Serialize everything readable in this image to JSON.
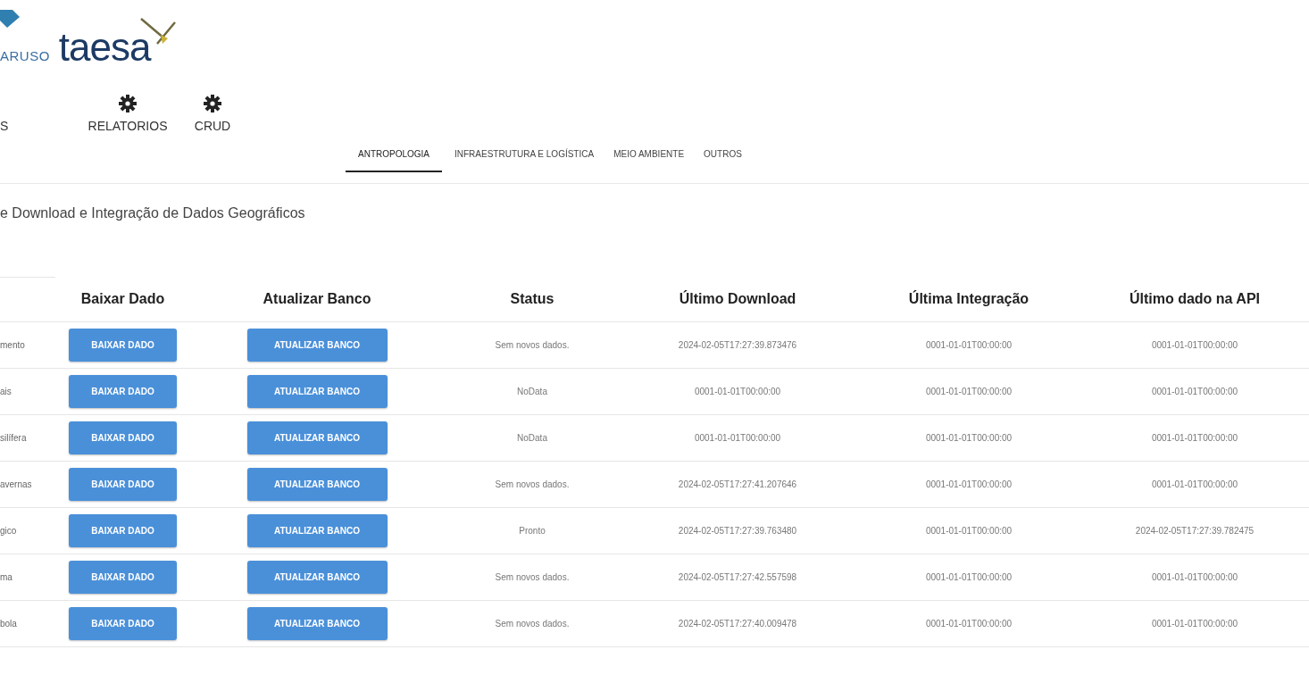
{
  "header": {
    "logo_left": "ARUSO",
    "logo_right": "taesa"
  },
  "nav": [
    {
      "label": "S"
    },
    {
      "label": "RELATORIOS"
    },
    {
      "label": "CRUD"
    }
  ],
  "tabs": [
    {
      "label": "ANTROPOLOGIA",
      "selected": true
    },
    {
      "label": "INFRAESTRUTURA E LOGÍSTICA",
      "selected": false
    },
    {
      "label": "MEIO AMBIENTE",
      "selected": false
    },
    {
      "label": "OUTROS",
      "selected": false
    }
  ],
  "page_title": "e Download e Integração de Dados Geográficos",
  "table": {
    "columns": [
      "",
      "Baixar Dado",
      "Atualizar Banco",
      "Status",
      "Último Download",
      "Última Integração",
      "Último dado na API"
    ],
    "rows": [
      {
        "name": "mento",
        "download_button": "BAIXAR DADO",
        "update_button": "ATUALIZAR BANCO",
        "status": "Sem novos dados.",
        "last_download": "2024-02-05T17:27:39.873476",
        "last_integration": "0001-01-01T00:00:00",
        "last_api": "0001-01-01T00:00:00"
      },
      {
        "name": "ais",
        "download_button": "BAIXAR DADO",
        "update_button": "ATUALIZAR BANCO",
        "status": "NoData",
        "last_download": "0001-01-01T00:00:00",
        "last_integration": "0001-01-01T00:00:00",
        "last_api": "0001-01-01T00:00:00"
      },
      {
        "name": "silífera",
        "download_button": "BAIXAR DADO",
        "update_button": "ATUALIZAR BANCO",
        "status": "NoData",
        "last_download": "0001-01-01T00:00:00",
        "last_integration": "0001-01-01T00:00:00",
        "last_api": "0001-01-01T00:00:00"
      },
      {
        "name": "avernas",
        "download_button": "BAIXAR DADO",
        "update_button": "ATUALIZAR BANCO",
        "status": "Sem novos dados.",
        "last_download": "2024-02-05T17:27:41.207646",
        "last_integration": "0001-01-01T00:00:00",
        "last_api": "0001-01-01T00:00:00"
      },
      {
        "name": "gico",
        "download_button": "BAIXAR DADO",
        "update_button": "ATUALIZAR BANCO",
        "status": "Pronto",
        "last_download": "2024-02-05T17:27:39.763480",
        "last_integration": "0001-01-01T00:00:00",
        "last_api": "2024-02-05T17:27:39.782475"
      },
      {
        "name": "ma",
        "download_button": "BAIXAR DADO",
        "update_button": "ATUALIZAR BANCO",
        "status": "Sem novos dados.",
        "last_download": "2024-02-05T17:27:42.557598",
        "last_integration": "0001-01-01T00:00:00",
        "last_api": "0001-01-01T00:00:00"
      },
      {
        "name": "bola",
        "download_button": "BAIXAR DADO",
        "update_button": "ATUALIZAR BANCO",
        "status": "Sem novos dados.",
        "last_download": "2024-02-05T17:27:40.009478",
        "last_integration": "0001-01-01T00:00:00",
        "last_api": "0001-01-01T00:00:00"
      }
    ]
  }
}
